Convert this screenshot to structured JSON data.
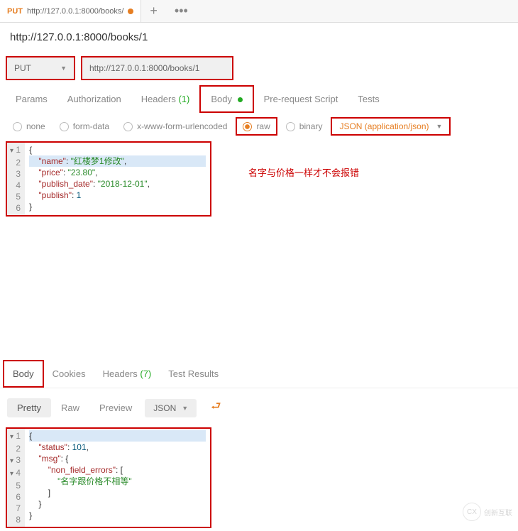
{
  "tab": {
    "method": "PUT",
    "url": "http://127.0.0.1:8000/books/",
    "dirty": true,
    "add_label": "+",
    "more_label": "•••"
  },
  "url_display": "http://127.0.0.1:8000/books/1",
  "request": {
    "method": "PUT",
    "url": "http://127.0.0.1:8000/books/1"
  },
  "req_tabs": {
    "params": "Params",
    "auth": "Authorization",
    "headers_label": "Headers",
    "headers_count": "(1)",
    "body": "Body",
    "prerequest": "Pre-request Script",
    "tests": "Tests"
  },
  "body_types": {
    "none": "none",
    "formdata": "form-data",
    "urlencoded": "x-www-form-urlencoded",
    "raw": "raw",
    "binary": "binary"
  },
  "content_type": "JSON (application/json)",
  "request_body": {
    "lines": [
      "1",
      "2",
      "3",
      "4",
      "5",
      "6"
    ],
    "json": {
      "name": "红楼梦1修改",
      "price": "23.80",
      "publish_date": "2018-12-01",
      "publish": 1
    }
  },
  "annotation": "名字与价格一样才不会报错",
  "resp_tabs": {
    "body": "Body",
    "cookies": "Cookies",
    "headers_label": "Headers",
    "headers_count": "(7)",
    "tests": "Test Results"
  },
  "resp_fmt": {
    "pretty": "Pretty",
    "raw": "Raw",
    "preview": "Preview",
    "json": "JSON"
  },
  "response_body": {
    "lines": [
      "1",
      "2",
      "3",
      "4",
      "5",
      "6",
      "7",
      "8"
    ],
    "json": {
      "status": 101,
      "msg": {
        "non_field_errors": [
          "名字跟价格不相等"
        ]
      }
    }
  },
  "watermark": "创新互联"
}
